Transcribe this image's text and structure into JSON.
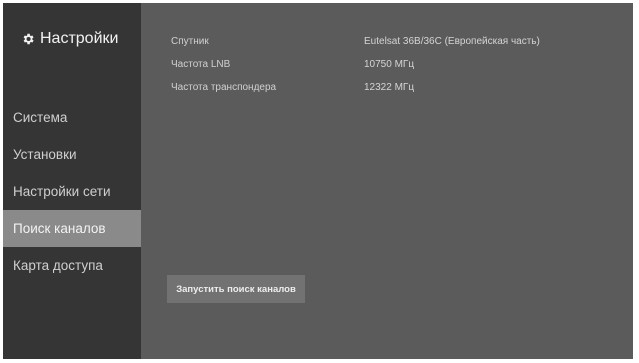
{
  "header": {
    "title": "Настройки",
    "icon": "gear-icon"
  },
  "sidebar": {
    "items": [
      {
        "label": "Система"
      },
      {
        "label": "Установки"
      },
      {
        "label": "Настройки сети"
      },
      {
        "label": "Поиск каналов",
        "active": true
      },
      {
        "label": "Карта доступа"
      }
    ]
  },
  "main": {
    "rows": [
      {
        "label": "Спутник",
        "value": "Eutelsat 36B/36C (Европейская часть)"
      },
      {
        "label": "Частота LNB",
        "value": "10750 МГц"
      },
      {
        "label": "Частота транспондера",
        "value": "12322 МГц"
      }
    ],
    "scan_button": "Запустить поиск каналов"
  },
  "colors": {
    "sidebar_bg": "#353535",
    "content_bg": "#5b5b5b",
    "active_item_bg": "#8a8a8a",
    "button_bg": "#727272"
  }
}
